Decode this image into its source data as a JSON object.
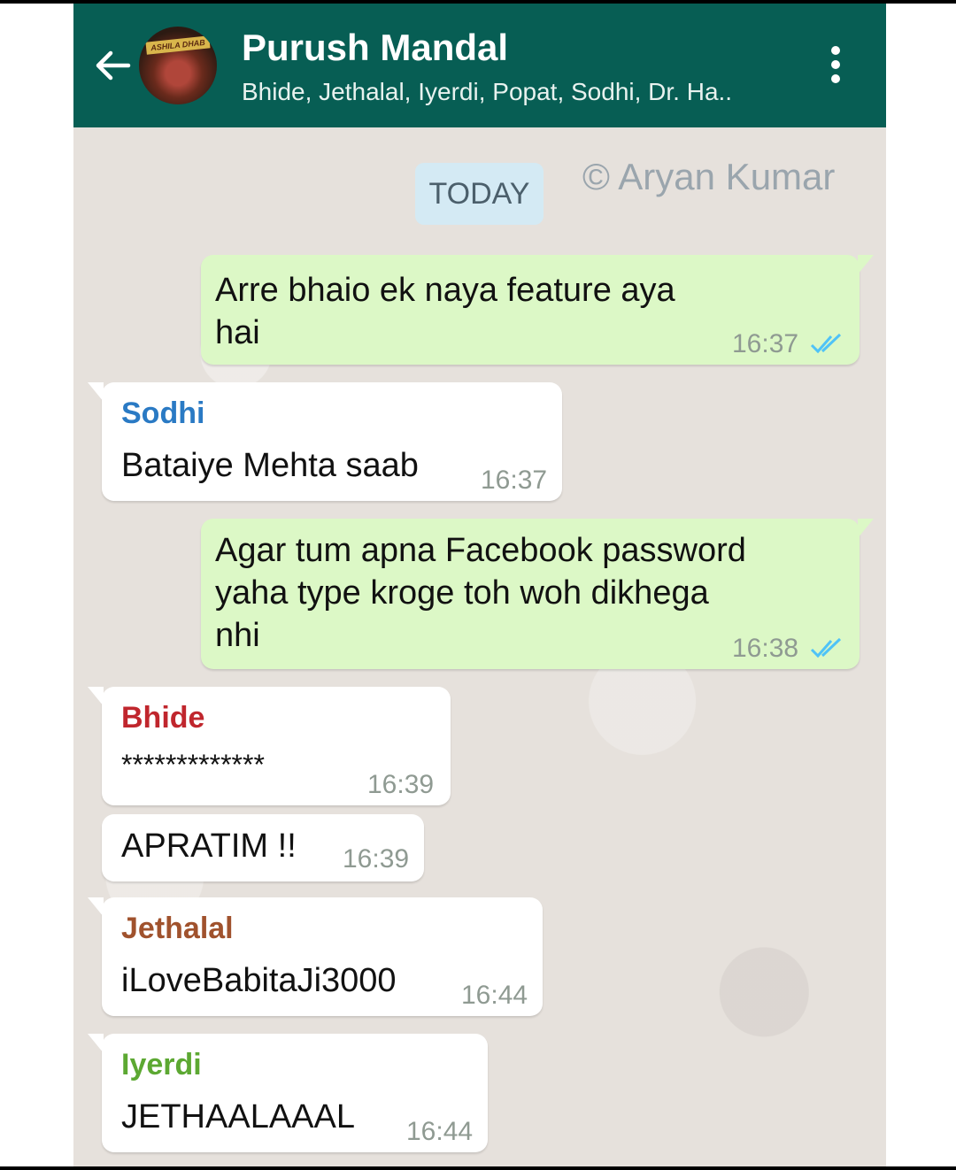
{
  "chat": {
    "title": "Purush Mandal",
    "members": "Bhide, Jethalal, Iyerdi, Popat, Sodhi, Dr. Ha..",
    "avatar_sign": "ASHILA DHAB"
  },
  "icons": {
    "back": "arrow-left-icon",
    "menu": "more-vert-icon",
    "read": "double-check-icon"
  },
  "colors": {
    "header": "#075e54",
    "outgoing_bubble": "#dcf8c6",
    "incoming_bubble": "#ffffff",
    "read_ticks": "#4fc3f7",
    "sodhi": "#2a7ac4",
    "bhide": "#c0262d",
    "jethalal": "#a0522d",
    "iyerdi": "#5ca832"
  },
  "date_chip": "TODAY",
  "watermark": "© Aryan Kumar",
  "messages": [
    {
      "direction": "out",
      "lines": [
        "Arre bhaio ek naya feature aya",
        "hai"
      ],
      "time": "16:37",
      "read": true
    },
    {
      "direction": "in",
      "sender": "Sodhi",
      "lines": [
        "Bataiye Mehta saab"
      ],
      "time": "16:37"
    },
    {
      "direction": "out",
      "lines": [
        "Agar tum apna Facebook password",
        "yaha type kroge toh woh dikhega",
        "nhi"
      ],
      "time": "16:38",
      "read": true
    },
    {
      "direction": "in",
      "sender": "Bhide",
      "lines": [
        "*************"
      ],
      "time": "16:39"
    },
    {
      "direction": "in",
      "lines": [
        "APRATIM !!"
      ],
      "time": "16:39"
    },
    {
      "direction": "in",
      "sender": "Jethalal",
      "lines": [
        "iLoveBabitaJi3000"
      ],
      "time": "16:44"
    },
    {
      "direction": "in",
      "sender": "Iyerdi",
      "lines": [
        "JETHAALAAAL"
      ],
      "time": "16:44"
    }
  ]
}
